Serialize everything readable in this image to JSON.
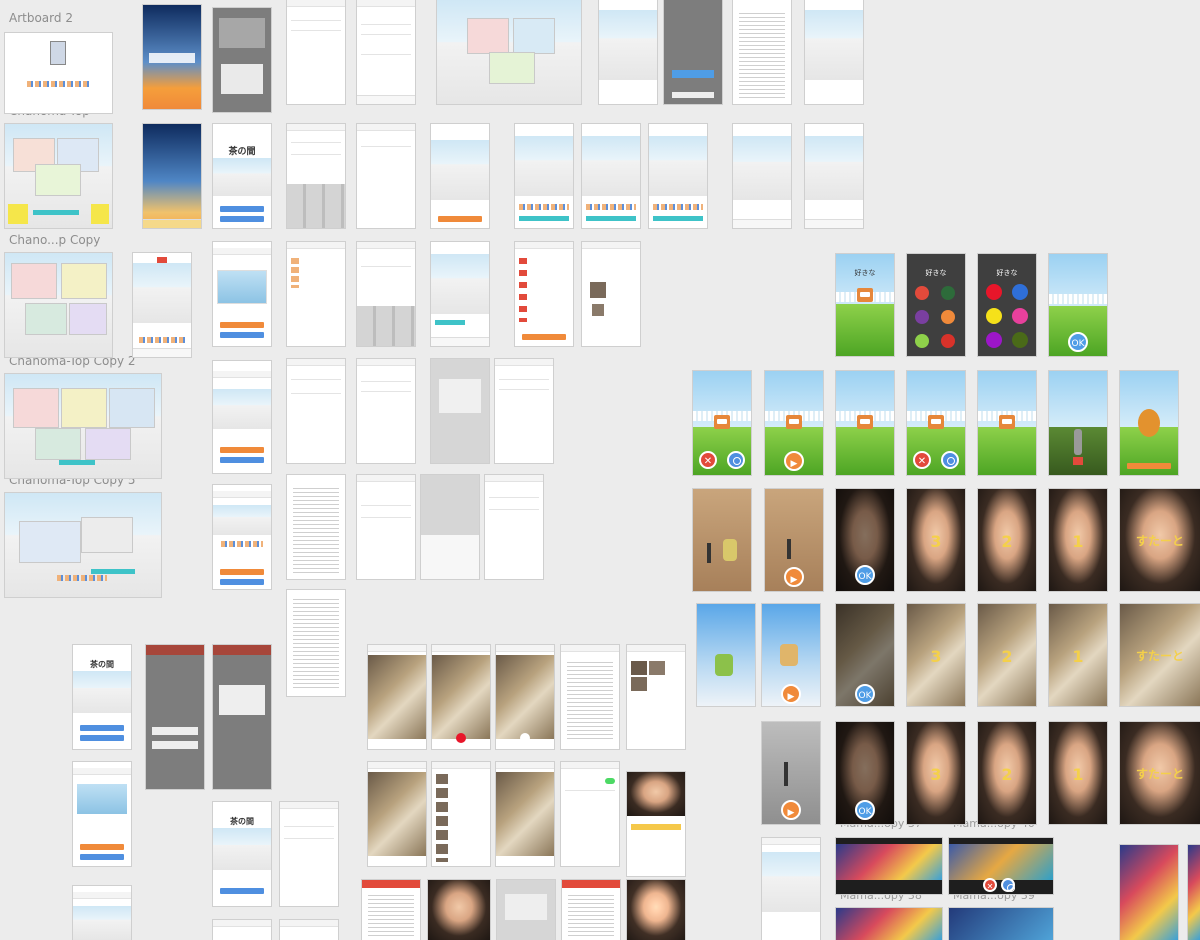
{
  "labels": {
    "artboard2": "Artboard 2",
    "top": "Chanoma-Top",
    "top_copy": "Chano...p Copy",
    "top_copy2": "Chanoma-Top Copy 2",
    "top_copy5": "Chanoma-Top Copy 5",
    "mama37": "Mama...opy 37",
    "mama40": "Mama...opy 40",
    "mama38": "Mama...opy 38",
    "mama39": "Mama...opy 39"
  },
  "tea_room_title": "茶の間",
  "ok": "OK",
  "countdown": [
    "3",
    "2",
    "1",
    "すたーと"
  ],
  "question_like": "好きな",
  "colors": {
    "accent": "#f08a3a",
    "blue": "#4f8fe0",
    "teal": "#3ec3c8",
    "grass": "#6dbb36",
    "canvas": "#ececec"
  },
  "icons": [
    "play-icon",
    "close-icon",
    "ok-icon",
    "check-icon"
  ]
}
